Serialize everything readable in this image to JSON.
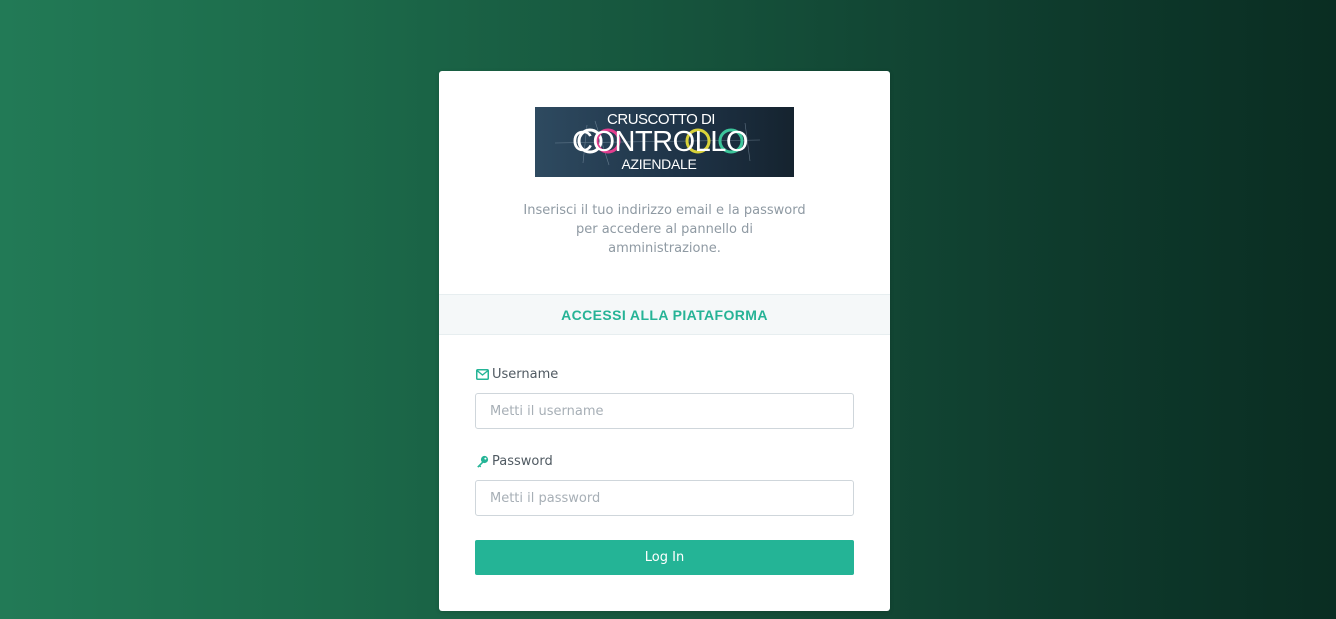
{
  "logo": {
    "line1": "CRUSCOTTO DI",
    "line2": "CONTROLLO",
    "line3": "AZIENDALE",
    "icon": "cruscotto-logo"
  },
  "intro": {
    "line1": "Inserisci il tuo indirizzo email e la password",
    "line2": "per accedere al pannello di",
    "line3": "amministrazione."
  },
  "section": {
    "title": "ACCESSI ALLA PIATAFORMA"
  },
  "form": {
    "username": {
      "label": "Username",
      "icon": "envelope-icon",
      "placeholder": "Metti il username",
      "value": ""
    },
    "password": {
      "label": "Password",
      "icon": "key-icon",
      "placeholder": "Metti il password",
      "value": ""
    },
    "submit_label": "Log In"
  },
  "colors": {
    "accent": "#24b496",
    "background_start": "#227a56",
    "background_end": "#0a2d22"
  }
}
